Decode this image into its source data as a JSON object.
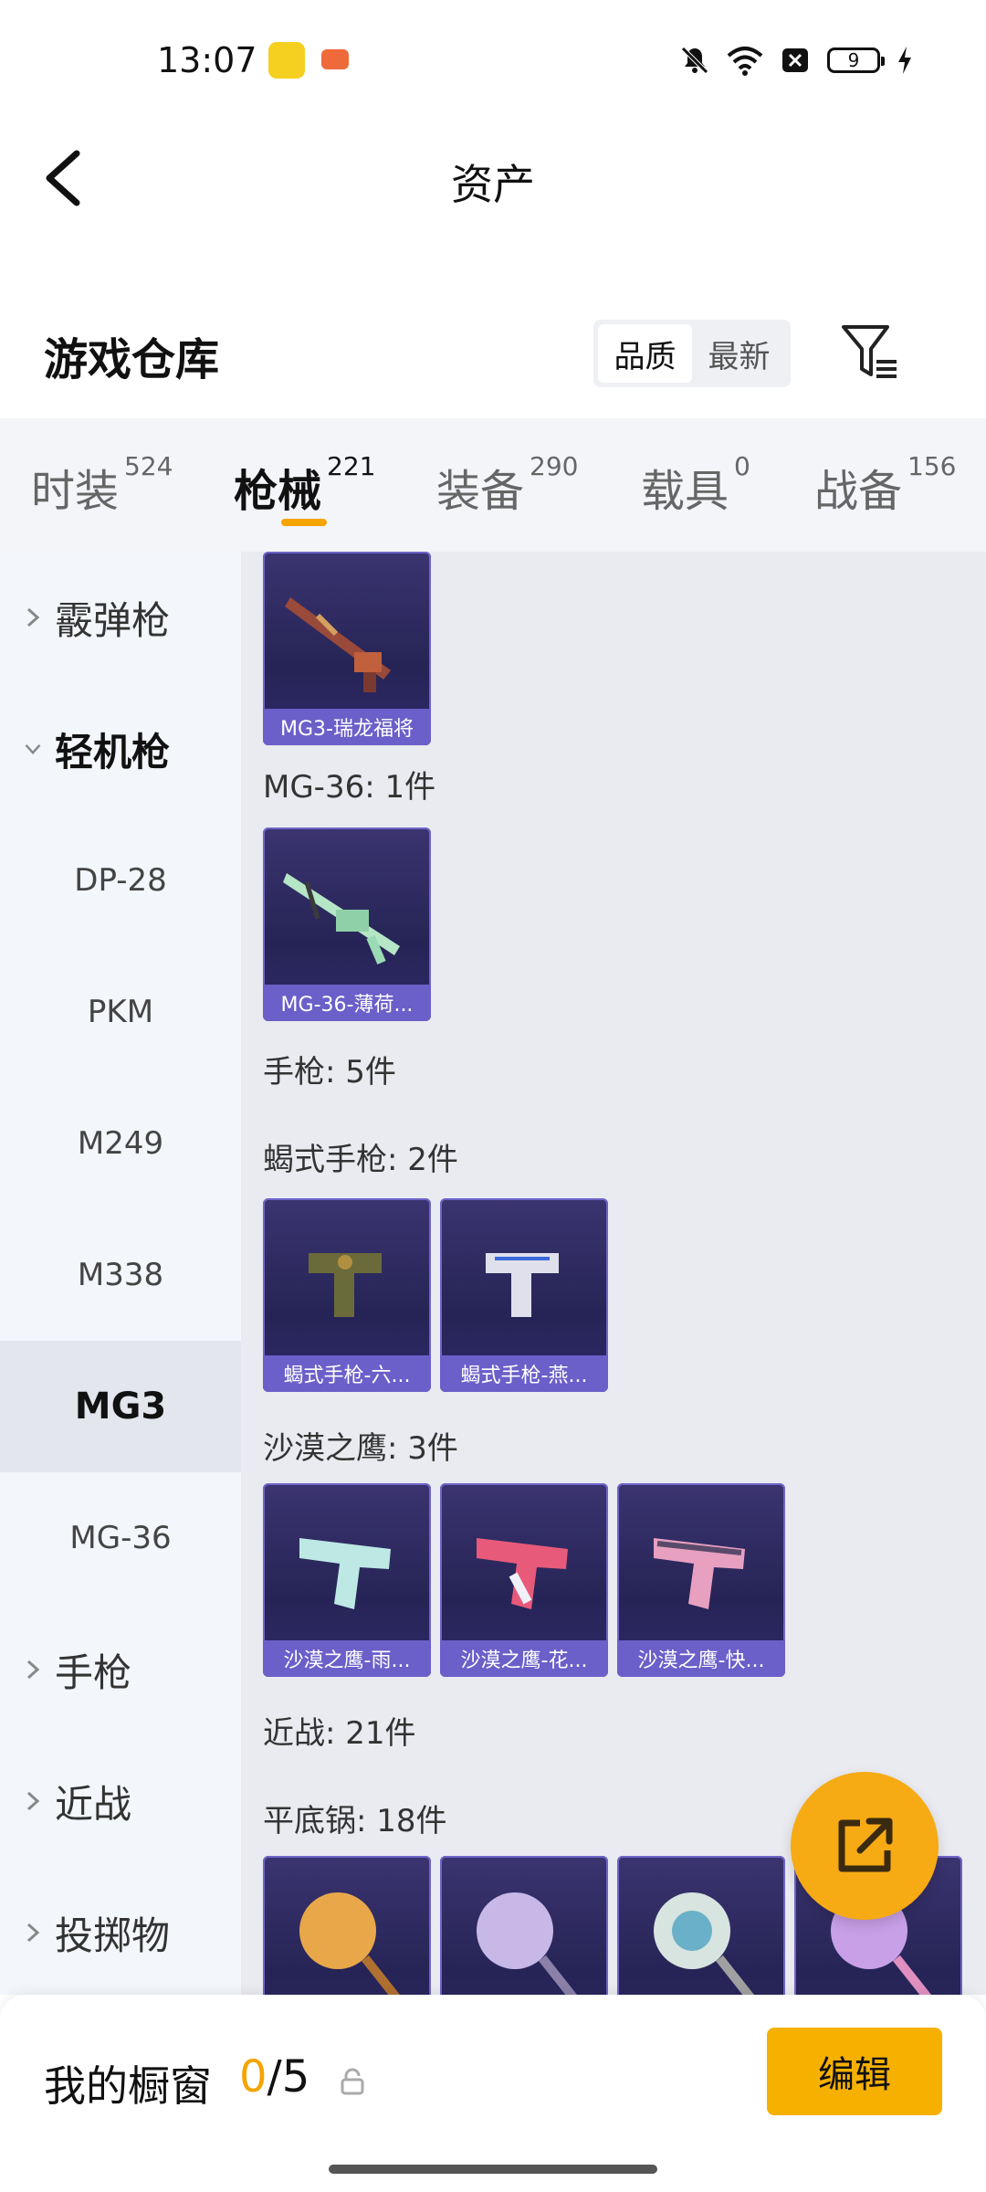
{
  "status_bar": {
    "time": "13:07",
    "battery": "9"
  },
  "header": {
    "title": "资产"
  },
  "warehouse": {
    "title": "游戏仓库",
    "sort_options": [
      {
        "label": "品质",
        "active": true
      },
      {
        "label": "最新",
        "active": false
      }
    ]
  },
  "tabs": [
    {
      "label": "时装",
      "count": "524"
    },
    {
      "label": "枪械",
      "count": "221",
      "active": true
    },
    {
      "label": "装备",
      "count": "290"
    },
    {
      "label": "载具",
      "count": "0"
    },
    {
      "label": "战备",
      "count": "156"
    }
  ],
  "sidebar": {
    "items": [
      {
        "label": "霰弹枪",
        "type": "parent"
      },
      {
        "label": "轻机枪",
        "type": "parent",
        "open": true
      },
      {
        "label": "DP-28",
        "type": "child"
      },
      {
        "label": "PKM",
        "type": "child"
      },
      {
        "label": "M249",
        "type": "child"
      },
      {
        "label": "M338",
        "type": "child"
      },
      {
        "label": "MG3",
        "type": "child",
        "selected": true
      },
      {
        "label": "MG-36",
        "type": "child"
      },
      {
        "label": "手枪",
        "type": "parent"
      },
      {
        "label": "近战",
        "type": "parent"
      },
      {
        "label": "投掷物",
        "type": "parent"
      }
    ]
  },
  "content": {
    "labels": {
      "mg36": "MG-36: 1件",
      "pistol": "手枪: 5件",
      "scorpion": "蝎式手枪: 2件",
      "deagle": "沙漠之鹰: 3件",
      "melee": "近战: 21件",
      "pan": "平底锅: 18件"
    },
    "cards": {
      "mg3": "MG3-瑞龙福将",
      "mg36": "MG-36-薄荷...",
      "scorpion1": "蝎式手枪-六...",
      "scorpion2": "蝎式手枪-燕...",
      "deagle1": "沙漠之鹰-雨...",
      "deagle2": "沙漠之鹰-花...",
      "deagle3": "沙漠之鹰-快..."
    }
  },
  "showcase": {
    "label": "我的橱窗",
    "used": "0",
    "separator": "/",
    "total": "5",
    "edit_label": "编辑"
  },
  "colors": {
    "accent": "#f6b000",
    "card_bg": "#2a275e",
    "card_caption": "#6b5fc9"
  }
}
